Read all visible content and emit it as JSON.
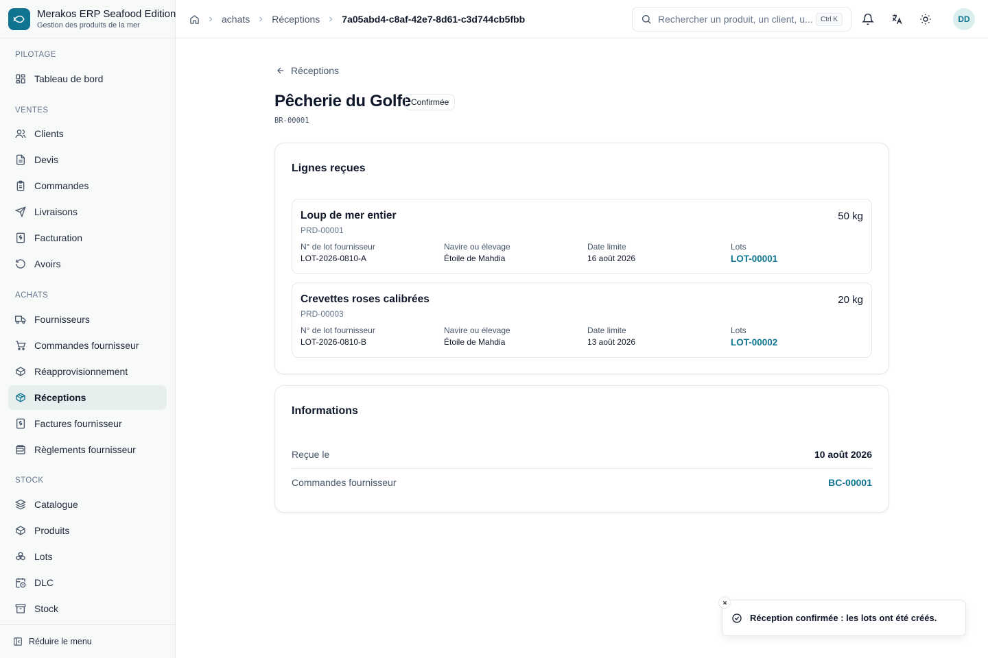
{
  "app": {
    "title": "Merakos ERP Seafood Edition",
    "subtitle": "Gestion des produits de la mer"
  },
  "sidebar": {
    "sections": [
      {
        "label": "PILOTAGE"
      },
      {
        "label": "VENTES"
      },
      {
        "label": "ACHATS"
      },
      {
        "label": "STOCK"
      }
    ],
    "items": [
      {
        "label": "Tableau de bord",
        "icon": "dashboard-icon"
      },
      {
        "label": "Clients",
        "icon": "users-icon"
      },
      {
        "label": "Devis",
        "icon": "file-text-icon"
      },
      {
        "label": "Commandes",
        "icon": "clipboard-icon"
      },
      {
        "label": "Livraisons",
        "icon": "send-icon"
      },
      {
        "label": "Facturation",
        "icon": "invoice-icon"
      },
      {
        "label": "Avoirs",
        "icon": "undo-icon"
      },
      {
        "label": "Fournisseurs",
        "icon": "truck-icon"
      },
      {
        "label": "Commandes fournisseur",
        "icon": "cart-icon"
      },
      {
        "label": "Réapprovisionnement",
        "icon": "package-refresh-icon"
      },
      {
        "label": "Réceptions",
        "icon": "package-check-icon",
        "active": true
      },
      {
        "label": "Factures fournisseur",
        "icon": "invoice-icon"
      },
      {
        "label": "Règlements fournisseur",
        "icon": "wallet-icon"
      },
      {
        "label": "Catalogue",
        "icon": "layers-icon"
      },
      {
        "label": "Produits",
        "icon": "box-icon"
      },
      {
        "label": "Lots",
        "icon": "boxes-icon"
      },
      {
        "label": "DLC",
        "icon": "calendar-clock-icon"
      },
      {
        "label": "Stock",
        "icon": "archive-icon"
      }
    ],
    "collapse_label": "Réduire le menu"
  },
  "header": {
    "breadcrumb": [
      "achats",
      "Réceptions",
      "7a05abd4-c8af-42e7-8d61-c3d744cb5fbb"
    ],
    "search_placeholder": "Rechercher un produit, un client, u...",
    "search_shortcut": "Ctrl K",
    "avatar_initials": "DD"
  },
  "page": {
    "back_label": "Réceptions",
    "title": "Pêcherie du Golfe",
    "status": "Confirmée",
    "reference": "BR-00001"
  },
  "lines_card": {
    "title": "Lignes reçues",
    "field_labels": {
      "supplier_lot": "N° de lot fournisseur",
      "vessel": "Navire ou élevage",
      "deadline": "Date limite",
      "lots": "Lots"
    },
    "lines": [
      {
        "product": "Loup de mer entier",
        "code": "PRD-00001",
        "quantity": "50 kg",
        "supplier_lot": "LOT-2026-0810-A",
        "vessel": "Étoile de Mahdia",
        "deadline": "16 août 2026",
        "lot": "LOT-00001"
      },
      {
        "product": "Crevettes roses calibrées",
        "code": "PRD-00003",
        "quantity": "20 kg",
        "supplier_lot": "LOT-2026-0810-B",
        "vessel": "Étoile de Mahdia",
        "deadline": "13 août 2026",
        "lot": "LOT-00002"
      }
    ]
  },
  "info_card": {
    "title": "Informations",
    "received_label": "Reçue le",
    "received_value": "10 août 2026",
    "orders_label": "Commandes fournisseur",
    "orders_value": "BC-00001"
  },
  "toast": {
    "message": "Réception confirmée : les lots ont été créés."
  },
  "colors": {
    "accent": "#0e7490",
    "active_bg": "#e6eeee"
  }
}
